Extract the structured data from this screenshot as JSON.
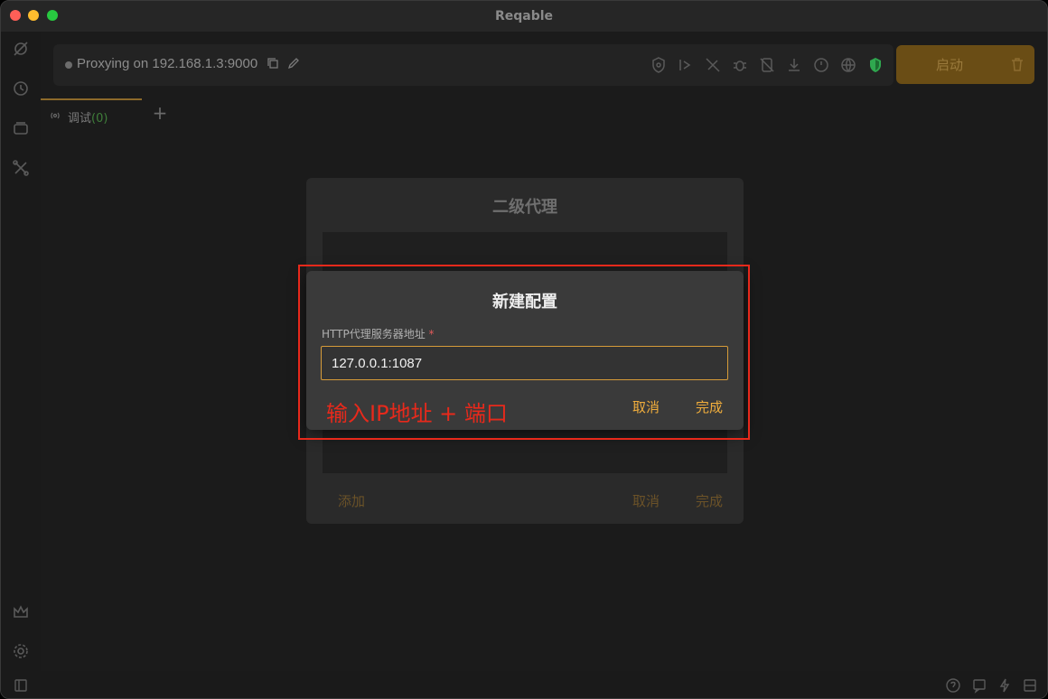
{
  "window": {
    "title": "Reqable"
  },
  "toolbar": {
    "proxy_status": "Proxying on 192.168.1.3:9000",
    "start_label": "启动"
  },
  "tabs": [
    {
      "label": "调试",
      "count": "(0)"
    }
  ],
  "background_dialog": {
    "title": "二级代理",
    "add_label": "添加",
    "cancel_label": "取消",
    "done_label": "完成"
  },
  "new_config_dialog": {
    "title": "新建配置",
    "field_label": "HTTP代理服务器地址",
    "required_mark": "*",
    "field_value": "127.0.0.1:1087",
    "cancel_label": "取消",
    "done_label": "完成"
  },
  "annotation": {
    "text": "输入IP地址 + 端口"
  },
  "colors": {
    "accent": "#f0ad3c",
    "annotation": "#e8291b",
    "input_border": "#d69b39",
    "shield_green": "#2fa84f"
  }
}
